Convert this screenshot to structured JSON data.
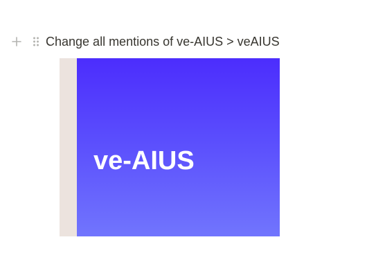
{
  "block": {
    "text": "Change all mentions of ve-AIUS > veAIUS",
    "add_icon": "plus-icon",
    "drag_icon": "drag-handle-icon"
  },
  "image": {
    "banner_text": "ve-AIUS",
    "colors": {
      "strip": "#ece3de",
      "gradient_top": "#4c2dfd",
      "gradient_bottom": "#7175fd",
      "text": "#ffffff"
    }
  }
}
